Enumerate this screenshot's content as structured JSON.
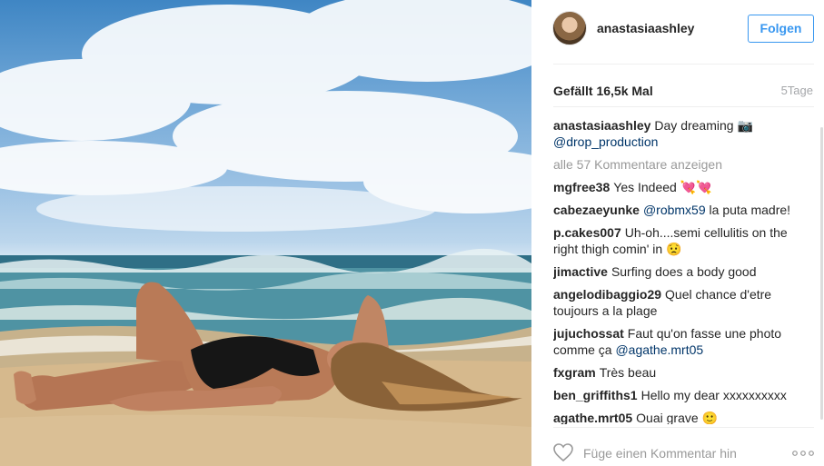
{
  "post": {
    "username": "anastasiaashley",
    "follow_label": "Folgen",
    "likes_text": "Gefällt 16,5k Mal",
    "time_text": "5Tage",
    "view_all_text": "alle 57 Kommentare anzeigen",
    "comment_placeholder": "Füge einen Kommentar hin"
  },
  "caption": {
    "user": "anastasiaashley",
    "text": "Day dreaming 📷",
    "mention": "@drop_production"
  },
  "comments": [
    {
      "user": "mgfree38",
      "text": "Yes Indeed 💘💘"
    },
    {
      "user": "cabezaeyunke",
      "mention": "@robmx59",
      "text": "la puta madre!"
    },
    {
      "user": "p.cakes007",
      "text": "Uh-oh....semi cellulitis on the right thigh comin' in 😟"
    },
    {
      "user": "jimactive",
      "text": "Surfing does a body good"
    },
    {
      "user": "angelodibaggio29",
      "text": "Quel chance d'etre toujours a la plage"
    },
    {
      "user": "jujuchossat",
      "text": "Faut qu'on fasse une photo comme ça",
      "mention_after": "@agathe.mrt05"
    },
    {
      "user": "fxgram",
      "text": "Très beau"
    },
    {
      "user": "ben_griffiths1",
      "text": "Hello my dear xxxxxxxxxx"
    },
    {
      "user": "agathe.mrt05",
      "text": "Ouai grave 🙂"
    }
  ],
  "icons": {
    "avatar": "profile-avatar",
    "like": "heart-outline-icon",
    "more": "three-dots-icon"
  },
  "colors": {
    "accent": "#3897f0",
    "mention": "#003569",
    "muted": "#999999"
  }
}
